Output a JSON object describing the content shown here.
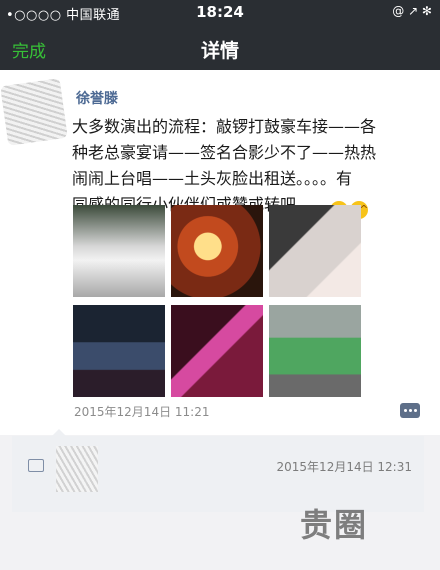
{
  "status_bar": {
    "carrier": "•○○○○ 中国联通",
    "time": "18:24",
    "right": "@ ↗ ✻"
  },
  "nav": {
    "done": "完成",
    "title": "详情"
  },
  "post": {
    "username": "徐誉滕",
    "content_line1": "大多数演出的流程：敲锣打鼓豪车接——各",
    "content_line2": "种老总豪宴请——签名合影少不了——热热",
    "content_line3": "闹闹上台唱——土头灰脸出租送。。。。有",
    "content_line4": "同感的同行小伙伴们或赞或转吧。。。",
    "emoji": "😆😆",
    "date": "2015年12月14日 11:21"
  },
  "comments": {
    "date": "2015年12月14日 12:31"
  },
  "watermark": {
    "main": "贵圈"
  }
}
